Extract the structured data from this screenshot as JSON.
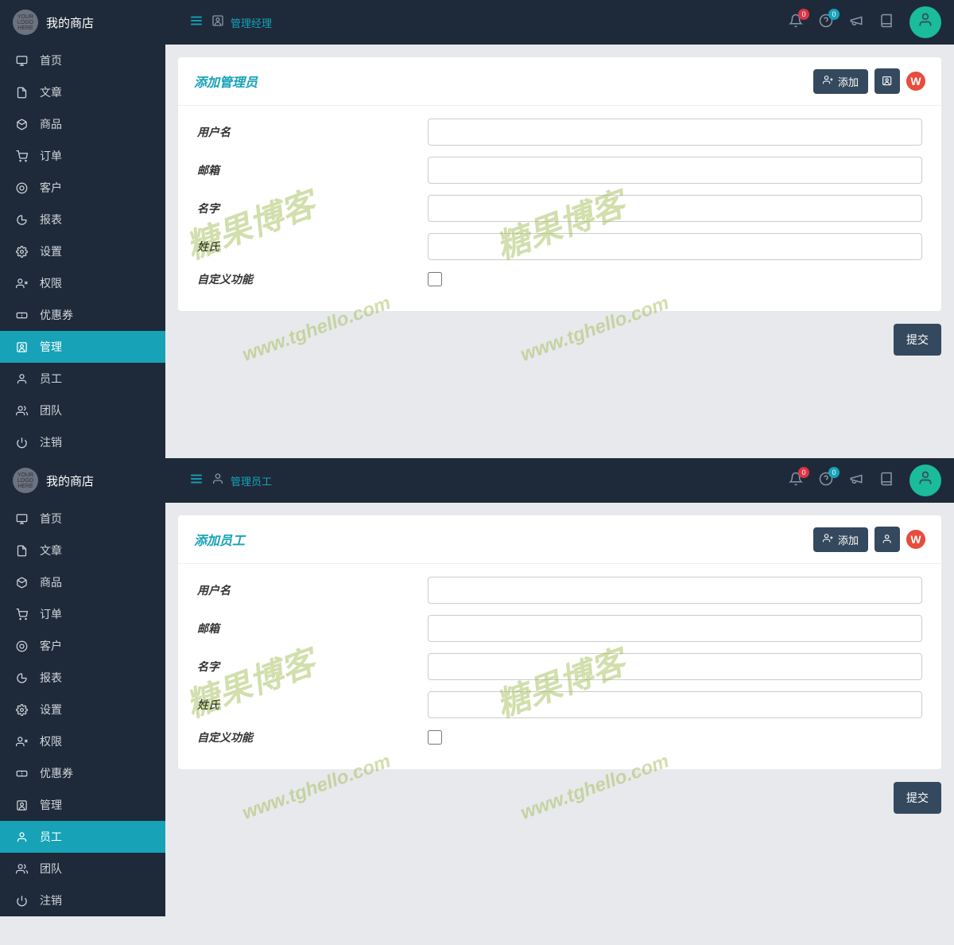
{
  "shared": {
    "logo_text": "YOUR LOGO HERE",
    "store_name": "我的商店",
    "notifications_count": "0",
    "help_count": "0",
    "add_button": "添加",
    "submit_button": "提交",
    "nav_items": [
      {
        "icon": "monitor",
        "label": "首页"
      },
      {
        "icon": "file",
        "label": "文章"
      },
      {
        "icon": "box",
        "label": "商品"
      },
      {
        "icon": "cart",
        "label": "订单"
      },
      {
        "icon": "target",
        "label": "客户"
      },
      {
        "icon": "chart",
        "label": "报表"
      },
      {
        "icon": "gear",
        "label": "设置"
      },
      {
        "icon": "user-x",
        "label": "权限"
      },
      {
        "icon": "coupon",
        "label": "优惠券"
      },
      {
        "icon": "manage",
        "label": "管理"
      },
      {
        "icon": "user",
        "label": "员工"
      },
      {
        "icon": "team",
        "label": "团队"
      },
      {
        "icon": "power",
        "label": "注销"
      }
    ],
    "form_fields": [
      {
        "label": "用户名",
        "type": "text"
      },
      {
        "label": "邮箱",
        "type": "text"
      },
      {
        "label": "名字",
        "type": "text"
      },
      {
        "label": "姓氏",
        "type": "text"
      },
      {
        "label": "自定义功能",
        "type": "checkbox"
      }
    ],
    "watermark_text": "糖果博客",
    "watermark_url": "www.tghello.com"
  },
  "panels": [
    {
      "breadcrumb": "管理经理",
      "card_title": "添加管理员",
      "active_nav": "管理",
      "action_icon": "manage"
    },
    {
      "breadcrumb": "管理员工",
      "card_title": "添加员工",
      "active_nav": "员工",
      "action_icon": "user"
    }
  ]
}
